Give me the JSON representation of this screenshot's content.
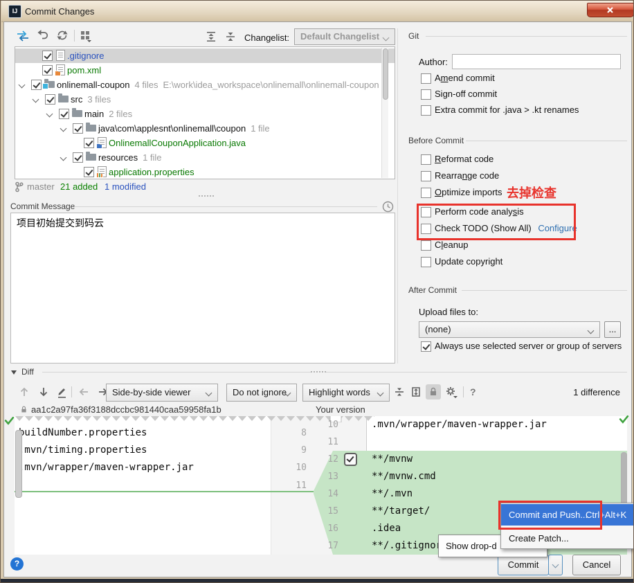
{
  "window": {
    "title": "Commit Changes",
    "logo_text": "IJ"
  },
  "colors": {
    "annotation_red": "#e8332c",
    "added_green": "#0a8000",
    "modified_blue": "#2a52be",
    "menu_selection_blue": "#3875d6",
    "diff_added_bg": "#c6e5c6"
  },
  "toolbar": {
    "changelist_label": "Changelist:",
    "changelist_value": "Default Changelist"
  },
  "tree": {
    "items": [
      {
        "name": ".gitignore",
        "checked": true,
        "selected": true
      },
      {
        "name": "pom.xml",
        "checked": true
      },
      {
        "name": "onlinemall-coupon",
        "meta": "4 files",
        "path": "E:\\work\\idea_workspace\\onlinemall\\onlinemall-coupon",
        "checked": true,
        "expanded": true
      },
      {
        "name": "src",
        "meta": "3 files",
        "checked": true,
        "expanded": true
      },
      {
        "name": "main",
        "meta": "2 files",
        "checked": true,
        "expanded": true
      },
      {
        "name": "java\\com\\applesnt\\onlinemall\\coupon",
        "meta": "1 file",
        "checked": true,
        "expanded": true
      },
      {
        "name": "OnlinemallCouponApplication.java",
        "checked": true
      },
      {
        "name": "resources",
        "meta": "1 file",
        "checked": true,
        "expanded": true
      },
      {
        "name": "application.properties",
        "checked": true
      }
    ]
  },
  "status": {
    "branch": "master",
    "added": "21 added",
    "modified": "1 modified"
  },
  "commit": {
    "label": "Commit Message",
    "text": "项目初始提交到码云"
  },
  "git": {
    "title": "Git",
    "author_label": "Author:",
    "author_value": "",
    "options": [
      {
        "label": "Amend commit",
        "u": 1,
        "checked": false
      },
      {
        "label": "Sign-off commit",
        "u": 2,
        "checked": false
      },
      {
        "label": "Extra commit for .java > .kt renames",
        "u": -1,
        "checked": false
      }
    ]
  },
  "before": {
    "title": "Before Commit",
    "annotation": "去掉检查",
    "options": [
      {
        "label": "Reformat code",
        "u": 0,
        "checked": false
      },
      {
        "label": "Rearrange code",
        "u": 6,
        "checked": false
      },
      {
        "label": "Optimize imports",
        "u": 0,
        "checked": false
      },
      {
        "label": "Perform code analysis",
        "u": 18,
        "checked": false
      },
      {
        "label": "Check TODO (Show All)",
        "u": -1,
        "checked": false
      },
      {
        "label": "Cleanup",
        "u": 1,
        "checked": false
      },
      {
        "label": "Update copyright",
        "u": -1,
        "checked": false
      }
    ],
    "todo_link": "Configure"
  },
  "after": {
    "title": "After Commit",
    "upload_label": "Upload files to:",
    "server_value": "(none)",
    "more_label": "...",
    "always_label": "Always use selected server or group of servers",
    "always_checked": true
  },
  "diff": {
    "title": "Diff",
    "viewer": "Side-by-side viewer",
    "ignore": "Do not ignore",
    "highlight": "Highlight words",
    "difference": "1 difference",
    "hash": "aa1c2a97fa36f3188dccbc981440caa59958fa1b",
    "right_title": "Your version",
    "left_lines": [
      {
        "n": "8",
        "t": "buildNumber.properties"
      },
      {
        "n": "9",
        "t": ".mvn/timing.properties"
      },
      {
        "n": "10",
        "t": ".mvn/wrapper/maven-wrapper.jar"
      },
      {
        "n": "11",
        "t": ""
      }
    ],
    "right_lines": [
      {
        "n": "10",
        "t": ".mvn/wrapper/maven-wrapper.jar",
        "added": false
      },
      {
        "n": "11",
        "t": "",
        "added": false
      },
      {
        "n": "12",
        "t": "**/mvnw",
        "added": true,
        "include_checked": true
      },
      {
        "n": "13",
        "t": "**/mvnw.cmd",
        "added": true
      },
      {
        "n": "14",
        "t": "**/.mvn",
        "added": true
      },
      {
        "n": "15",
        "t": "**/target/",
        "added": true
      },
      {
        "n": "16",
        "t": ".idea",
        "added": true
      },
      {
        "n": "17",
        "t": "**/.gitignore",
        "added": true
      }
    ]
  },
  "popup": {
    "items": [
      {
        "label": "Commit and Push...",
        "shortcut": "Ctrl+Alt+K",
        "selected": true
      },
      {
        "label": "Create Patch...",
        "selected": false
      }
    ]
  },
  "tooltip": {
    "text": "Show drop-d"
  },
  "footer": {
    "commit": "Commit",
    "cancel": "Cancel",
    "help": "?"
  }
}
